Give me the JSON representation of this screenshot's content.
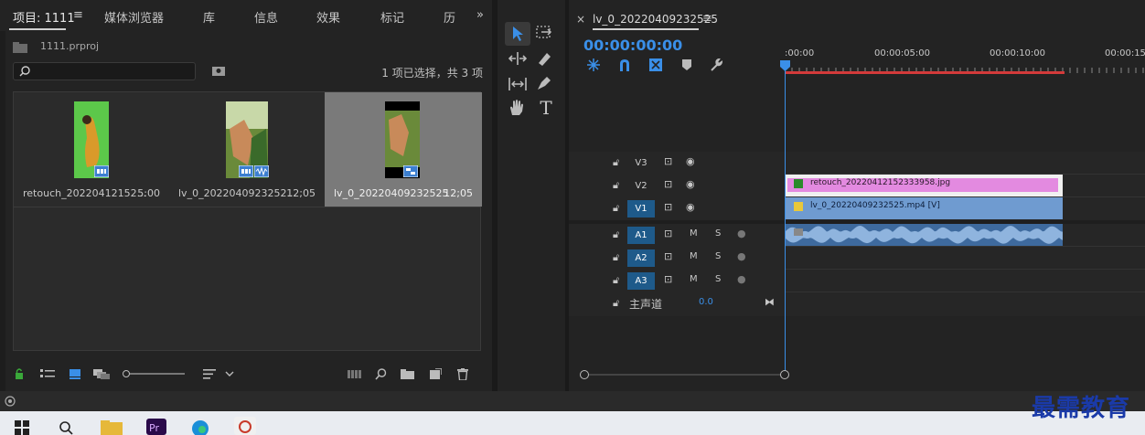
{
  "project_panel": {
    "tabs": [
      "项目: 1111",
      "媒体浏览器",
      "库",
      "信息",
      "效果",
      "标记",
      "历"
    ],
    "menu_icon": "hamburger-icon",
    "overflow_icon": "double-chevron-right-icon",
    "file_name": "1111.prproj",
    "search_placeholder": "",
    "selection_info": "1 项已选择，共 3 项",
    "clips": [
      {
        "name": "retouch_20220412152...",
        "duration": "5:00",
        "selected": false
      },
      {
        "name": "lv_0_2022040923252...",
        "duration": "12;05",
        "selected": false
      },
      {
        "name": "lv_0_20220409232525",
        "duration": "12;05",
        "selected": true
      }
    ]
  },
  "tools": {
    "items": [
      "selection-tool",
      "track-select-forward-tool",
      "ripple-edit-tool",
      "razor-tool",
      "slip-tool",
      "pen-tool",
      "hand-tool",
      "type-tool"
    ]
  },
  "timeline": {
    "close_symbol": "×",
    "sequence_name": "lv_0_20220409232525",
    "timecode": "00:00:00:00",
    "ruler_labels": [
      ":00:00",
      "00:00:05:00",
      "00:00:10:00",
      "00:00:15:"
    ],
    "tracks": [
      {
        "id": "V3",
        "type": "video",
        "target": false
      },
      {
        "id": "V2",
        "type": "video",
        "target": false
      },
      {
        "id": "V1",
        "type": "video",
        "target": true
      },
      {
        "id": "A1",
        "type": "audio",
        "target": true,
        "m": "M",
        "s": "S"
      },
      {
        "id": "A2",
        "type": "audio",
        "target": true,
        "m": "M",
        "s": "S"
      },
      {
        "id": "A3",
        "type": "audio",
        "target": true,
        "m": "M",
        "s": "S"
      }
    ],
    "master": {
      "label": "主声道",
      "value": "0.0"
    },
    "clips": {
      "v2": "retouch_20220412152333958.jpg",
      "v1": "lv_0_20220409232525.mp4 [V]"
    },
    "colors": {
      "accent": "#3a8fe8",
      "v2_clip": "#e38ae0",
      "v1_clip": "#6f9bd0",
      "audio_clip": "#5f8bc0",
      "work_area": "#d33a3a"
    }
  },
  "watermark": "最需教育"
}
